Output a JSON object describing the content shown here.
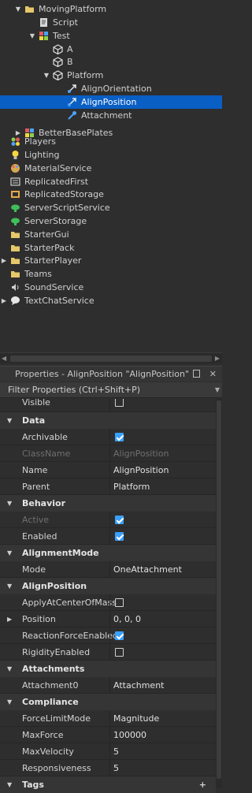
{
  "explorer": {
    "items": [
      {
        "label": "MovingPlatform",
        "arrow": "▼",
        "icon": "folder-icon",
        "color": "#e6c86a"
      },
      {
        "label": "Script",
        "arrow": "",
        "icon": "script-icon",
        "color": "#cccccc"
      },
      {
        "label": "Test",
        "arrow": "▼",
        "icon": "model-icon",
        "color": "#e05a5a"
      },
      {
        "label": "A",
        "arrow": "",
        "icon": "part-icon",
        "color": "#cccccc"
      },
      {
        "label": "B",
        "arrow": "",
        "icon": "part-icon",
        "color": "#cccccc"
      },
      {
        "label": "Platform",
        "arrow": "▼",
        "icon": "part-icon",
        "color": "#cccccc"
      },
      {
        "label": "AlignOrientation",
        "arrow": "",
        "icon": "align-orientation-icon",
        "color": "#cccccc"
      },
      {
        "label": "AlignPosition",
        "arrow": "",
        "icon": "align-position-icon",
        "color": "#ffffff"
      },
      {
        "label": "Attachment",
        "arrow": "",
        "icon": "attachment-icon",
        "color": "#4aa3ff"
      },
      {
        "label": "BetterBasePlates",
        "arrow": "▶",
        "icon": "model-icon",
        "color": "#e6e6e6"
      },
      {
        "label": "Players",
        "arrow": "",
        "icon": "players-icon",
        "color": "#8fd14f"
      },
      {
        "label": "Lighting",
        "arrow": "",
        "icon": "lightbulb-icon",
        "color": "#f5d742"
      },
      {
        "label": "MaterialService",
        "arrow": "",
        "icon": "material-service-icon",
        "color": "#e0a050"
      },
      {
        "label": "ReplicatedFirst",
        "arrow": "",
        "icon": "replicated-first-icon",
        "color": "#cccccc"
      },
      {
        "label": "ReplicatedStorage",
        "arrow": "",
        "icon": "replicated-storage-icon",
        "color": "#e6a84a"
      },
      {
        "label": "ServerScriptService",
        "arrow": "",
        "icon": "server-script-service-icon",
        "color": "#3fbf5a"
      },
      {
        "label": "ServerStorage",
        "arrow": "",
        "icon": "server-storage-icon",
        "color": "#3fbf5a"
      },
      {
        "label": "StarterGui",
        "arrow": "",
        "icon": "starter-gui-icon",
        "color": "#e6c86a"
      },
      {
        "label": "StarterPack",
        "arrow": "",
        "icon": "starter-pack-icon",
        "color": "#e6c86a"
      },
      {
        "label": "StarterPlayer",
        "arrow": "▶",
        "icon": "starter-player-icon",
        "color": "#e6c86a"
      },
      {
        "label": "Teams",
        "arrow": "",
        "icon": "teams-icon",
        "color": "#e6c86a"
      },
      {
        "label": "SoundService",
        "arrow": "",
        "icon": "sound-service-icon",
        "color": "#cccccc"
      },
      {
        "label": "TextChatService",
        "arrow": "▶",
        "icon": "text-chat-service-icon",
        "color": "#e6e6e6"
      }
    ]
  },
  "properties": {
    "title": "Properties - AlignPosition \"AlignPosition\"",
    "filter_placeholder": "Filter Properties (Ctrl+Shift+P)",
    "rows": [
      {
        "type": "prop",
        "name": "Visible",
        "value": "",
        "check": false,
        "partial": true
      },
      {
        "type": "cat",
        "name": "Data"
      },
      {
        "type": "prop",
        "name": "Archivable",
        "value": "",
        "check": true
      },
      {
        "type": "prop",
        "name": "ClassName",
        "value": "AlignPosition",
        "disabled": true
      },
      {
        "type": "prop",
        "name": "Name",
        "value": "AlignPosition"
      },
      {
        "type": "prop",
        "name": "Parent",
        "value": "Platform"
      },
      {
        "type": "cat",
        "name": "Behavior"
      },
      {
        "type": "prop",
        "name": "Active",
        "value": "",
        "check": true,
        "disabled": true
      },
      {
        "type": "prop",
        "name": "Enabled",
        "value": "",
        "check": true
      },
      {
        "type": "cat",
        "name": "AlignmentMode"
      },
      {
        "type": "prop",
        "name": "Mode",
        "value": "OneAttachment"
      },
      {
        "type": "cat",
        "name": "AlignPosition"
      },
      {
        "type": "prop",
        "name": "ApplyAtCenterOfMass",
        "value": "",
        "check": false
      },
      {
        "type": "prop",
        "name": "Position",
        "value": "0, 0, 0",
        "expand": true
      },
      {
        "type": "prop",
        "name": "ReactionForceEnabled",
        "value": "",
        "check": true
      },
      {
        "type": "prop",
        "name": "RigidityEnabled",
        "value": "",
        "check": false
      },
      {
        "type": "cat",
        "name": "Attachments"
      },
      {
        "type": "prop",
        "name": "Attachment0",
        "value": "Attachment"
      },
      {
        "type": "cat",
        "name": "Compliance"
      },
      {
        "type": "prop",
        "name": "ForceLimitMode",
        "value": "Magnitude"
      },
      {
        "type": "prop",
        "name": "MaxForce",
        "value": "100000"
      },
      {
        "type": "prop",
        "name": "MaxVelocity",
        "value": "5"
      },
      {
        "type": "prop",
        "name": "Responsiveness",
        "value": "5"
      },
      {
        "type": "cat",
        "name": "Tags"
      }
    ]
  }
}
